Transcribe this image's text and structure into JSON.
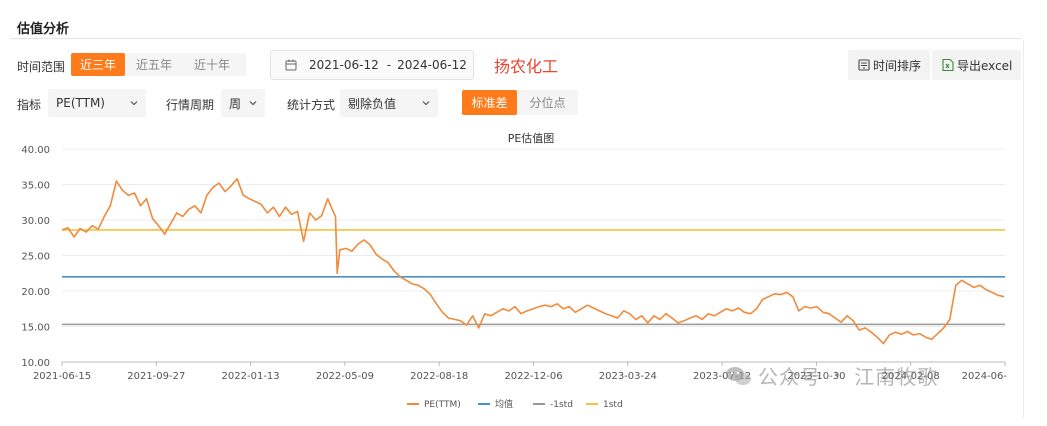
{
  "section_title": "估值分析",
  "time_range": {
    "label": "时间范围",
    "options": [
      "近三年",
      "近五年",
      "近十年"
    ],
    "selected": "近三年"
  },
  "date_range": {
    "start": "2021-06-12",
    "separator": "-",
    "end": "2024-06-12"
  },
  "company_name": "扬农化工",
  "toolbar": {
    "sort_label": "时间排序",
    "export_label": "导出excel"
  },
  "filters": {
    "indicator_label": "指标",
    "indicator_value": "PE(TTM)",
    "period_label": "行情周期",
    "period_value": "周",
    "stat_label": "统计方式",
    "stat_value": "剔除负值",
    "mode_options": [
      "标准差",
      "分位点"
    ],
    "mode_selected": "标准差"
  },
  "colors": {
    "accent": "#ff7a1a",
    "company": "#e8452c",
    "pe_line": "#f08a3c",
    "mean_line": "#4a90c8",
    "minus_std_line": "#999999",
    "plus_std_line": "#f5c342"
  },
  "watermark": {
    "icon": "wechat-icon",
    "prefix": "公众号",
    "name": "江南牧歌"
  },
  "chart_data": {
    "type": "line",
    "title": "PE估值图",
    "ylim": [
      10,
      40
    ],
    "y_ticks": [
      "40.00",
      "35.00",
      "30.00",
      "25.00",
      "20.00",
      "15.00",
      "10.00"
    ],
    "x_range": [
      "2021-06-15",
      "2024-06-12"
    ],
    "x_ticks": [
      "2021-06-15",
      "2021-09-27",
      "2022-01-13",
      "2022-05-09",
      "2022-08-18",
      "2022-12-06",
      "2023-03-24",
      "2023-07-12",
      "2023-10-30",
      "2024-02-08",
      "2024-06-"
    ],
    "legend": [
      "PE(TTM)",
      "均值",
      "-1std",
      "1std"
    ],
    "legend_position": "bottom",
    "grid": true,
    "reference_lines": {
      "mean": 22.0,
      "minus_1std": 15.3,
      "plus_1std": 28.6
    },
    "series": [
      {
        "name": "PE(TTM)",
        "points": [
          [
            "2021-06-15",
            28.6
          ],
          [
            "2021-06-22",
            28.9
          ],
          [
            "2021-06-29",
            27.6
          ],
          [
            "2021-07-06",
            28.8
          ],
          [
            "2021-07-13",
            28.3
          ],
          [
            "2021-07-20",
            29.2
          ],
          [
            "2021-07-27",
            28.7
          ],
          [
            "2021-08-03",
            30.5
          ],
          [
            "2021-08-10",
            32.0
          ],
          [
            "2021-08-17",
            35.5
          ],
          [
            "2021-08-24",
            34.2
          ],
          [
            "2021-08-31",
            33.5
          ],
          [
            "2021-09-07",
            33.8
          ],
          [
            "2021-09-14",
            32.0
          ],
          [
            "2021-09-21",
            33.0
          ],
          [
            "2021-09-28",
            30.2
          ],
          [
            "2021-10-05",
            29.2
          ],
          [
            "2021-10-12",
            28.0
          ],
          [
            "2021-10-19",
            29.5
          ],
          [
            "2021-10-26",
            31.0
          ],
          [
            "2021-11-02",
            30.5
          ],
          [
            "2021-11-09",
            31.5
          ],
          [
            "2021-11-16",
            32.0
          ],
          [
            "2021-11-23",
            31.0
          ],
          [
            "2021-11-30",
            33.5
          ],
          [
            "2021-12-07",
            34.6
          ],
          [
            "2021-12-14",
            35.2
          ],
          [
            "2021-12-21",
            34.0
          ],
          [
            "2021-12-28",
            34.8
          ],
          [
            "2022-01-04",
            35.8
          ],
          [
            "2022-01-11",
            33.5
          ],
          [
            "2022-01-18",
            33.0
          ],
          [
            "2022-01-25",
            32.6
          ],
          [
            "2022-02-01",
            32.2
          ],
          [
            "2022-02-08",
            31.0
          ],
          [
            "2022-02-15",
            31.8
          ],
          [
            "2022-02-22",
            30.5
          ],
          [
            "2022-03-01",
            31.8
          ],
          [
            "2022-03-08",
            30.8
          ],
          [
            "2022-03-15",
            31.2
          ],
          [
            "2022-03-22",
            27.0
          ],
          [
            "2022-03-29",
            31.0
          ],
          [
            "2022-04-05",
            30.0
          ],
          [
            "2022-04-12",
            30.6
          ],
          [
            "2022-04-19",
            33.0
          ],
          [
            "2022-04-26",
            31.0
          ],
          [
            "2022-04-28",
            30.5
          ],
          [
            "2022-04-30",
            22.5
          ],
          [
            "2022-05-03",
            25.8
          ],
          [
            "2022-05-10",
            26.0
          ],
          [
            "2022-05-17",
            25.6
          ],
          [
            "2022-05-24",
            26.6
          ],
          [
            "2022-05-31",
            27.2
          ],
          [
            "2022-06-07",
            26.5
          ],
          [
            "2022-06-14",
            25.2
          ],
          [
            "2022-06-21",
            24.5
          ],
          [
            "2022-06-28",
            24.0
          ],
          [
            "2022-07-05",
            22.8
          ],
          [
            "2022-07-12",
            22.0
          ],
          [
            "2022-07-19",
            21.5
          ],
          [
            "2022-07-26",
            21.0
          ],
          [
            "2022-08-02",
            20.8
          ],
          [
            "2022-08-09",
            20.3
          ],
          [
            "2022-08-16",
            19.5
          ],
          [
            "2022-08-23",
            18.2
          ],
          [
            "2022-08-30",
            17.0
          ],
          [
            "2022-09-06",
            16.2
          ],
          [
            "2022-09-13",
            16.0
          ],
          [
            "2022-09-20",
            15.8
          ],
          [
            "2022-09-27",
            15.2
          ],
          [
            "2022-10-04",
            16.5
          ],
          [
            "2022-10-11",
            14.8
          ],
          [
            "2022-10-18",
            16.8
          ],
          [
            "2022-10-25",
            16.5
          ],
          [
            "2022-11-01",
            17.0
          ],
          [
            "2022-11-08",
            17.5
          ],
          [
            "2022-11-15",
            17.2
          ],
          [
            "2022-11-22",
            17.8
          ],
          [
            "2022-11-29",
            16.8
          ],
          [
            "2022-12-06",
            17.2
          ],
          [
            "2022-12-13",
            17.5
          ],
          [
            "2022-12-20",
            17.8
          ],
          [
            "2022-12-27",
            18.0
          ],
          [
            "2023-01-03",
            17.8
          ],
          [
            "2023-01-10",
            18.2
          ],
          [
            "2023-01-17",
            17.5
          ],
          [
            "2023-01-24",
            17.8
          ],
          [
            "2023-01-31",
            17.0
          ],
          [
            "2023-02-07",
            17.5
          ],
          [
            "2023-02-14",
            18.0
          ],
          [
            "2023-02-21",
            17.6
          ],
          [
            "2023-02-28",
            17.2
          ],
          [
            "2023-03-07",
            16.8
          ],
          [
            "2023-03-14",
            16.5
          ],
          [
            "2023-03-21",
            16.2
          ],
          [
            "2023-03-28",
            17.2
          ],
          [
            "2023-04-04",
            16.8
          ],
          [
            "2023-04-11",
            16.0
          ],
          [
            "2023-04-18",
            16.5
          ],
          [
            "2023-04-25",
            15.5
          ],
          [
            "2023-05-02",
            16.5
          ],
          [
            "2023-05-09",
            16.0
          ],
          [
            "2023-05-16",
            16.8
          ],
          [
            "2023-05-23",
            16.2
          ],
          [
            "2023-05-30",
            15.5
          ],
          [
            "2023-06-06",
            15.8
          ],
          [
            "2023-06-13",
            16.2
          ],
          [
            "2023-06-20",
            16.5
          ],
          [
            "2023-06-27",
            16.0
          ],
          [
            "2023-07-04",
            16.8
          ],
          [
            "2023-07-11",
            16.5
          ],
          [
            "2023-07-18",
            17.0
          ],
          [
            "2023-07-25",
            17.5
          ],
          [
            "2023-08-01",
            17.2
          ],
          [
            "2023-08-08",
            17.6
          ],
          [
            "2023-08-15",
            17.0
          ],
          [
            "2023-08-22",
            16.8
          ],
          [
            "2023-08-29",
            17.5
          ],
          [
            "2023-09-05",
            18.8
          ],
          [
            "2023-09-12",
            19.2
          ],
          [
            "2023-09-19",
            19.6
          ],
          [
            "2023-09-26",
            19.5
          ],
          [
            "2023-10-03",
            19.8
          ],
          [
            "2023-10-10",
            19.2
          ],
          [
            "2023-10-17",
            17.2
          ],
          [
            "2023-10-24",
            17.8
          ],
          [
            "2023-10-31",
            17.6
          ],
          [
            "2023-11-07",
            17.8
          ],
          [
            "2023-11-14",
            17.0
          ],
          [
            "2023-11-21",
            16.8
          ],
          [
            "2023-11-28",
            16.2
          ],
          [
            "2023-12-05",
            15.6
          ],
          [
            "2023-12-12",
            16.5
          ],
          [
            "2023-12-19",
            15.8
          ],
          [
            "2023-12-26",
            14.5
          ],
          [
            "2024-01-02",
            14.8
          ],
          [
            "2024-01-09",
            14.2
          ],
          [
            "2024-01-16",
            13.5
          ],
          [
            "2024-01-23",
            12.6
          ],
          [
            "2024-01-30",
            13.8
          ],
          [
            "2024-02-06",
            14.2
          ],
          [
            "2024-02-13",
            13.9
          ],
          [
            "2024-02-20",
            14.3
          ],
          [
            "2024-02-27",
            13.8
          ],
          [
            "2024-03-05",
            14.0
          ],
          [
            "2024-03-12",
            13.5
          ],
          [
            "2024-03-19",
            13.2
          ],
          [
            "2024-03-26",
            14.0
          ],
          [
            "2024-04-02",
            14.8
          ],
          [
            "2024-04-09",
            16.0
          ],
          [
            "2024-04-16",
            20.8
          ],
          [
            "2024-04-23",
            21.5
          ],
          [
            "2024-04-30",
            21.0
          ],
          [
            "2024-05-07",
            20.5
          ],
          [
            "2024-05-14",
            20.8
          ],
          [
            "2024-05-21",
            20.2
          ],
          [
            "2024-05-28",
            19.8
          ],
          [
            "2024-06-04",
            19.4
          ],
          [
            "2024-06-11",
            19.2
          ]
        ]
      }
    ]
  }
}
